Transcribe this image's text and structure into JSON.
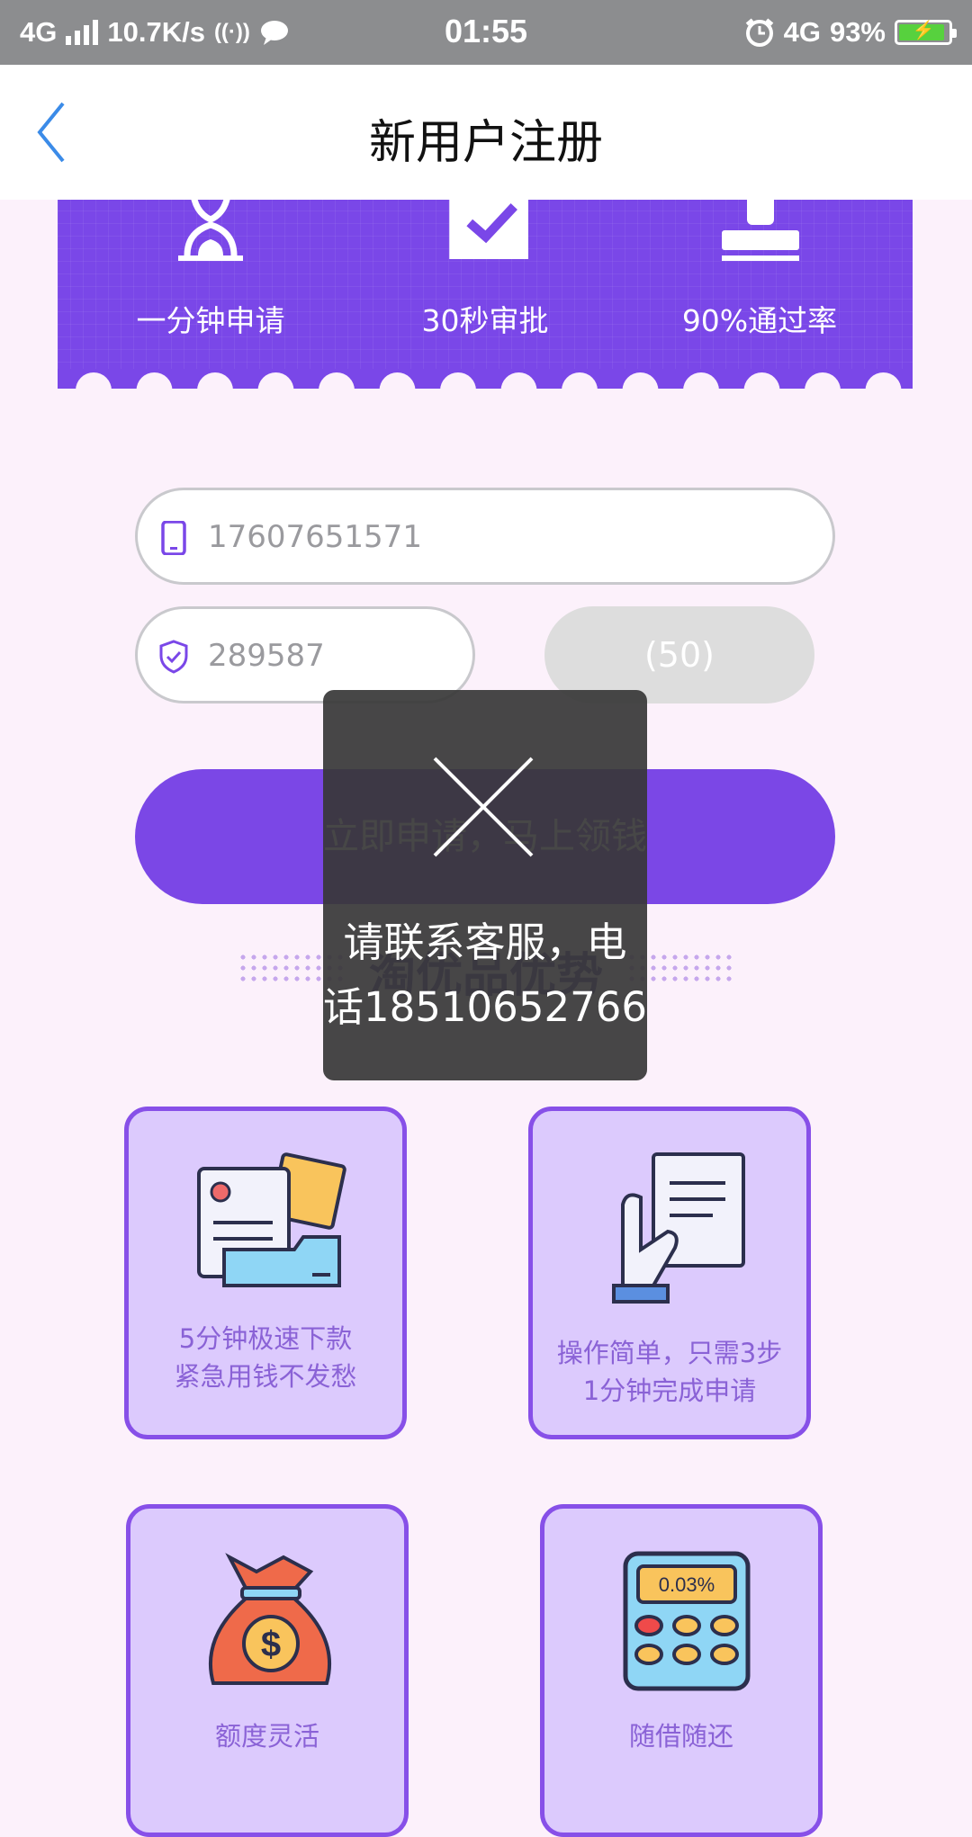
{
  "status_bar": {
    "network": "4G",
    "speed": "10.7K/s",
    "time": "01:55",
    "network_right": "4G",
    "battery_percent": "93%",
    "battery_level": 0.93
  },
  "header": {
    "title": "新用户注册"
  },
  "banner": {
    "features": [
      {
        "label": "一分钟申请",
        "icon": "hourglass-icon"
      },
      {
        "label": "30秒审批",
        "icon": "checkbox-icon"
      },
      {
        "label": "90%通过率",
        "icon": "stamp-icon"
      }
    ]
  },
  "form": {
    "phone_value": "17607651571",
    "code_value": "289587",
    "code_button": "(50)",
    "apply_button": "立即申请，马上领钱"
  },
  "section": {
    "title": "淘优品优势"
  },
  "cards": [
    {
      "line1": "5分钟极速下款",
      "line2": "紧急用钱不发愁"
    },
    {
      "line1": "操作简单，只需3步",
      "line2": "1分钟完成申请"
    },
    {
      "line1": "额度灵活",
      "line2": ""
    },
    {
      "line1": "随借随还",
      "line2": ""
    }
  ],
  "calculator_display": "0.03%",
  "toast": {
    "line1": "请联系客服，电",
    "line2": "话18510652766"
  },
  "colors": {
    "accent": "#7b47e6",
    "card_bg": "#dccafd",
    "page_bg": "#fcf1fb"
  }
}
